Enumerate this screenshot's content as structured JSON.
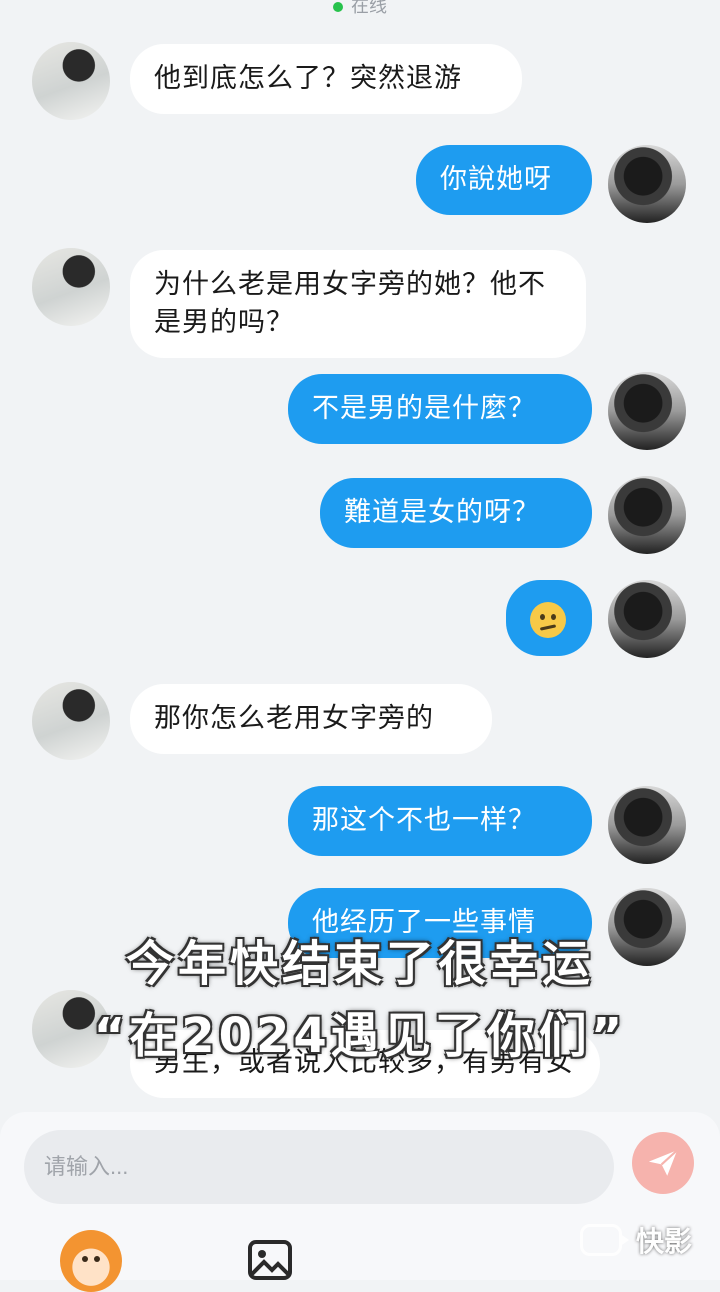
{
  "header": {
    "status_text": "在线",
    "status_color": "#27c24c"
  },
  "messages": [
    {
      "side": "in",
      "text": "他到底怎么了？突然退游"
    },
    {
      "side": "out",
      "text": "你說她呀"
    },
    {
      "side": "in",
      "text": "为什么老是用女字旁的她？他不是男的吗？"
    },
    {
      "side": "out",
      "text": "不是男的是什麼？"
    },
    {
      "side": "out",
      "text": "難道是女的呀？"
    },
    {
      "side": "out",
      "emoji": "confused-face"
    },
    {
      "side": "in",
      "text": "那你怎么老用女字旁的"
    },
    {
      "side": "out",
      "text": "那这个不也一样？"
    },
    {
      "side": "out",
      "text": "他经历了一些事情"
    },
    {
      "side": "in",
      "text": "男生，或者说人比较多，有男有女"
    }
  ],
  "overlay": {
    "line1": "今年快结束了很幸运",
    "line2": "“在2024遇见了你们”"
  },
  "composer": {
    "placeholder": "请输入...",
    "send_color": "#f6b3ad"
  },
  "watermark": {
    "text": "快影"
  },
  "colors": {
    "outgoing_bubble": "#1e9cf0",
    "incoming_bubble": "#ffffff",
    "background": "#f1f3f5"
  }
}
